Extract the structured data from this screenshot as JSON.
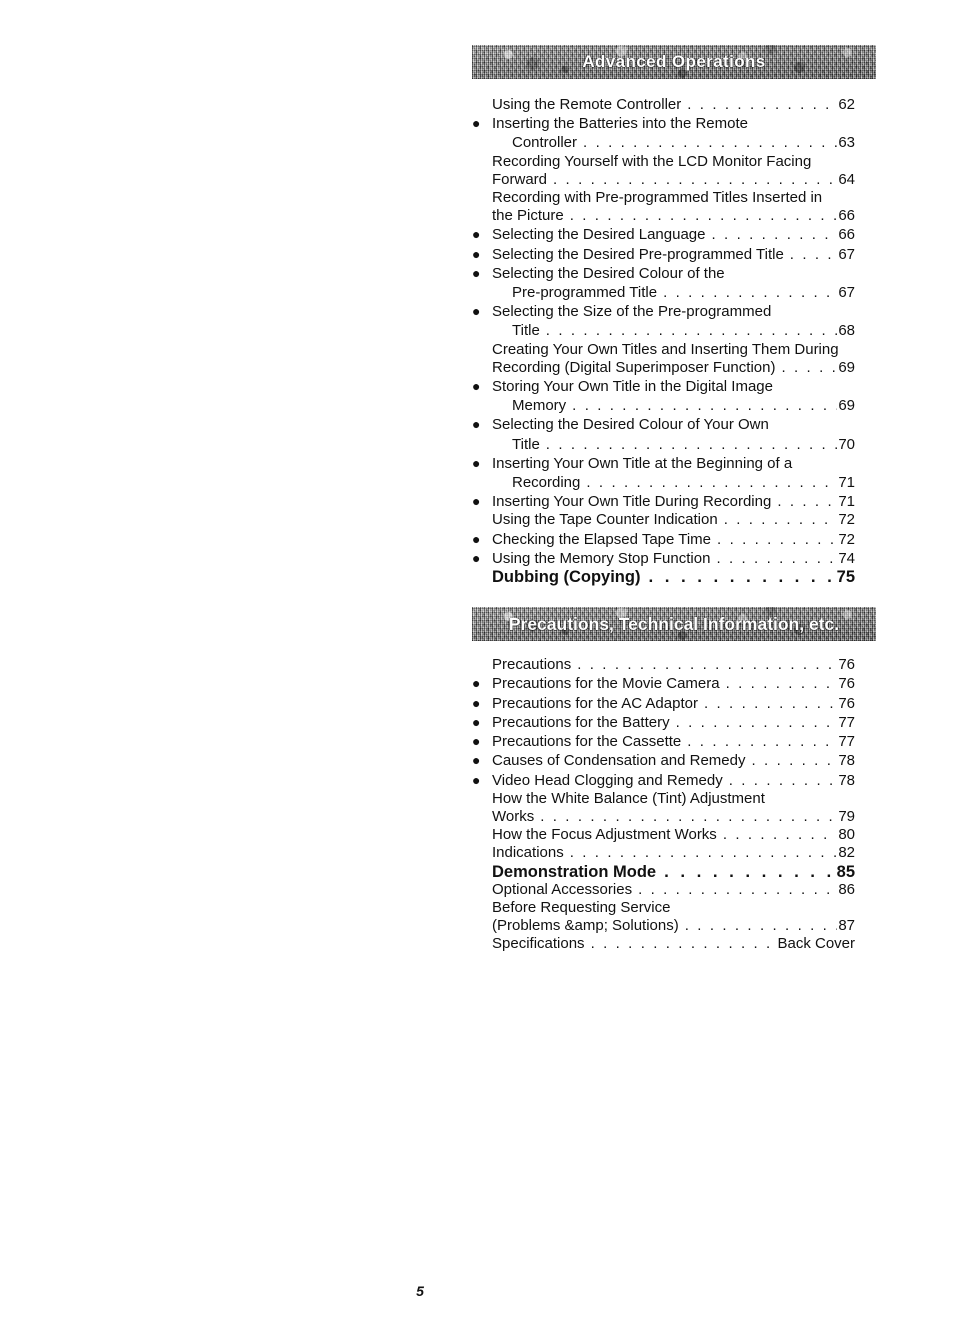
{
  "page": {
    "folio": "5"
  },
  "sections": [
    {
      "banner": "Advanced Operations",
      "entries": [
        {
          "bullet": false,
          "bold": false,
          "lines": [
            "Using the Remote Controller"
          ],
          "page": "62"
        },
        {
          "bullet": true,
          "bold": false,
          "lines": [
            "Inserting the Batteries into the Remote",
            "Controller"
          ],
          "page": "63"
        },
        {
          "bullet": false,
          "bold": false,
          "lines": [
            "Recording Yourself with the LCD Monitor Facing",
            "Forward"
          ],
          "page": "64"
        },
        {
          "bullet": false,
          "bold": false,
          "lines": [
            "Recording with Pre-programmed Titles Inserted in",
            "the Picture"
          ],
          "page": "66"
        },
        {
          "bullet": true,
          "bold": false,
          "lines": [
            "Selecting the Desired Language"
          ],
          "page": "66"
        },
        {
          "bullet": true,
          "bold": false,
          "lines": [
            "Selecting the Desired Pre-programmed Title"
          ],
          "page": "67"
        },
        {
          "bullet": true,
          "bold": false,
          "lines": [
            "Selecting the Desired Colour of the",
            "Pre-programmed Title"
          ],
          "page": "67"
        },
        {
          "bullet": true,
          "bold": false,
          "lines": [
            "Selecting the Size of the Pre-programmed",
            "Title"
          ],
          "page": "68"
        },
        {
          "bullet": false,
          "bold": false,
          "lines": [
            "Creating Your Own Titles and Inserting Them During",
            "Recording (Digital Superimposer Function)"
          ],
          "page": "69"
        },
        {
          "bullet": true,
          "bold": false,
          "lines": [
            "Storing Your Own Title in the Digital Image",
            "Memory"
          ],
          "page": "69"
        },
        {
          "bullet": true,
          "bold": false,
          "lines": [
            "Selecting the Desired Colour of Your Own",
            "Title"
          ],
          "page": "70"
        },
        {
          "bullet": true,
          "bold": false,
          "lines": [
            "Inserting Your Own Title at the Beginning of a",
            "Recording"
          ],
          "page": "71"
        },
        {
          "bullet": true,
          "bold": false,
          "lines": [
            "Inserting Your Own Title During Recording"
          ],
          "page": "71"
        },
        {
          "bullet": false,
          "bold": false,
          "lines": [
            "Using the Tape Counter Indication"
          ],
          "page": "72"
        },
        {
          "bullet": true,
          "bold": false,
          "lines": [
            "Checking the Elapsed Tape Time"
          ],
          "page": "72"
        },
        {
          "bullet": true,
          "bold": false,
          "lines": [
            "Using the Memory Stop Function"
          ],
          "page": "74"
        },
        {
          "bullet": false,
          "bold": true,
          "lines": [
            "Dubbing (Copying)"
          ],
          "page": "75"
        }
      ]
    },
    {
      "banner": "Precautions, Technical Information, etc.",
      "entries": [
        {
          "bullet": false,
          "bold": false,
          "lines": [
            "Precautions"
          ],
          "page": "76"
        },
        {
          "bullet": true,
          "bold": false,
          "lines": [
            "Precautions for the Movie Camera"
          ],
          "page": "76"
        },
        {
          "bullet": true,
          "bold": false,
          "lines": [
            "Precautions for the AC Adaptor"
          ],
          "page": "76"
        },
        {
          "bullet": true,
          "bold": false,
          "lines": [
            "Precautions for the Battery"
          ],
          "page": "77"
        },
        {
          "bullet": true,
          "bold": false,
          "lines": [
            "Precautions for the Cassette"
          ],
          "page": "77"
        },
        {
          "bullet": true,
          "bold": false,
          "lines": [
            "Causes of Condensation and Remedy"
          ],
          "page": "78"
        },
        {
          "bullet": true,
          "bold": false,
          "lines": [
            "Video Head Clogging and Remedy"
          ],
          "page": "78"
        },
        {
          "bullet": false,
          "bold": false,
          "lines": [
            "How the White Balance (Tint) Adjustment",
            "Works"
          ],
          "page": "79"
        },
        {
          "bullet": false,
          "bold": false,
          "lines": [
            "How the Focus Adjustment Works"
          ],
          "page": "80"
        },
        {
          "bullet": false,
          "bold": false,
          "lines": [
            "Indications"
          ],
          "page": "82"
        },
        {
          "bullet": false,
          "bold": true,
          "lines": [
            "Demonstration Mode"
          ],
          "page": "85"
        },
        {
          "bullet": false,
          "bold": false,
          "lines": [
            "Optional Accessories"
          ],
          "page": "86"
        },
        {
          "bullet": false,
          "bold": false,
          "lines": [
            "Before Requesting Service",
            "(Problems &amp; Solutions)"
          ],
          "page": "87"
        },
        {
          "bullet": false,
          "bold": false,
          "lines": [
            "Specifications"
          ],
          "page": "Back Cover"
        }
      ]
    }
  ],
  "bullet_glyph": "●"
}
